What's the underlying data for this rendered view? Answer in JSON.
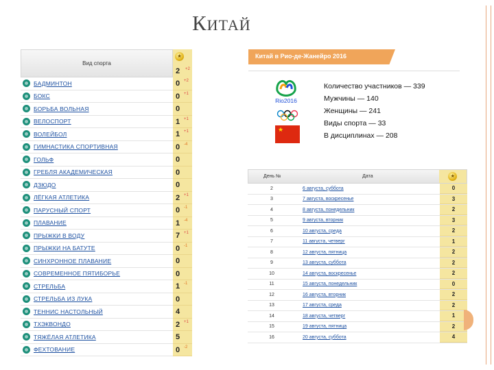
{
  "slide": {
    "title": "Китай"
  },
  "sports_table": {
    "header_label": "Вид спорта",
    "header_count": "2",
    "header_delta": "+2",
    "rows": [
      {
        "name": "БАДМИНТОН",
        "count": "0",
        "delta": "+2"
      },
      {
        "name": "БОКС",
        "count": "0",
        "delta": "+1"
      },
      {
        "name": "БОРЬБА ВОЛЬНАЯ",
        "count": "0",
        "delta": ""
      },
      {
        "name": "ВЕЛОСПОРТ",
        "count": "1",
        "delta": "+1"
      },
      {
        "name": "ВОЛЕЙБОЛ",
        "count": "1",
        "delta": "+1"
      },
      {
        "name": "ГИМНАСТИКА СПОРТИВНАЯ",
        "count": "0",
        "delta": "-4"
      },
      {
        "name": "ГОЛЬФ",
        "count": "0",
        "delta": ""
      },
      {
        "name": "ГРЕБЛЯ АКАДЕМИЧЕСКАЯ",
        "count": "0",
        "delta": ""
      },
      {
        "name": "ДЗЮДО",
        "count": "0",
        "delta": ""
      },
      {
        "name": "ЛЁГКАЯ АТЛЕТИКА",
        "count": "2",
        "delta": "+1"
      },
      {
        "name": "ПАРУСНЫЙ СПОРТ",
        "count": "0",
        "delta": "-1"
      },
      {
        "name": "ПЛАВАНИЕ",
        "count": "1",
        "delta": "-4"
      },
      {
        "name": "ПРЫЖКИ В ВОДУ",
        "count": "7",
        "delta": "+1"
      },
      {
        "name": "ПРЫЖКИ НА БАТУТЕ",
        "count": "0",
        "delta": "-1"
      },
      {
        "name": "СИНХРОННОЕ ПЛАВАНИЕ",
        "count": "0",
        "delta": ""
      },
      {
        "name": "СОВРЕМЕННОЕ ПЯТИБОРЬЕ",
        "count": "0",
        "delta": ""
      },
      {
        "name": "СТРЕЛЬБА",
        "count": "1",
        "delta": "-1"
      },
      {
        "name": "СТРЕЛЬБА ИЗ ЛУКА",
        "count": "0",
        "delta": ""
      },
      {
        "name": "ТЕННИС НАСТОЛЬНЫЙ",
        "count": "4",
        "delta": ""
      },
      {
        "name": "ТХЭКВОНДО",
        "count": "2",
        "delta": "+1"
      },
      {
        "name": "ТЯЖЁЛАЯ АТЛЕТИКА",
        "count": "5",
        "delta": ""
      },
      {
        "name": "ФЕХТОВАНИЕ",
        "count": "0",
        "delta": "-2"
      }
    ]
  },
  "info": {
    "header": "Китай в Рио-де-Жанейро 2016",
    "logo_text": "Rio2016",
    "stats": [
      "Количество участников — 339",
      "Мужчины — 140",
      "Женщины — 241",
      "Виды спорта — 33",
      "В дисциплинах — 208"
    ]
  },
  "days_table": {
    "header_day": "День №",
    "header_date": "Дата",
    "rows": [
      {
        "day": "2",
        "date": "6 августа, суббота",
        "medals": "0"
      },
      {
        "day": "3",
        "date": "7 августа, воскресенье",
        "medals": "3"
      },
      {
        "day": "4",
        "date": "8 августа, понедельник",
        "medals": "2"
      },
      {
        "day": "5",
        "date": "9 августа, вторник",
        "medals": "3"
      },
      {
        "day": "6",
        "date": "10 августа, среда",
        "medals": "2"
      },
      {
        "day": "7",
        "date": "11 августа, четверг",
        "medals": "1"
      },
      {
        "day": "8",
        "date": "12 августа, пятница",
        "medals": "2"
      },
      {
        "day": "9",
        "date": "13 августа, суббота",
        "medals": "2"
      },
      {
        "day": "10",
        "date": "14 августа, воскресенье",
        "medals": "2"
      },
      {
        "day": "11",
        "date": "15 августа, понедельник",
        "medals": "0"
      },
      {
        "day": "12",
        "date": "16 августа, вторник",
        "medals": "2"
      },
      {
        "day": "13",
        "date": "17 августа, среда",
        "medals": "2"
      },
      {
        "day": "14",
        "date": "18 августа, четверг",
        "medals": "1"
      },
      {
        "day": "15",
        "date": "19 августа, пятница",
        "medals": "2"
      },
      {
        "day": "16",
        "date": "20 августа, суббота",
        "medals": "4"
      }
    ]
  },
  "colors": {
    "accent": "#f0a55a",
    "medal_column": "#f5e6a0",
    "link": "#1b4fa0",
    "flag": "#de2910"
  }
}
